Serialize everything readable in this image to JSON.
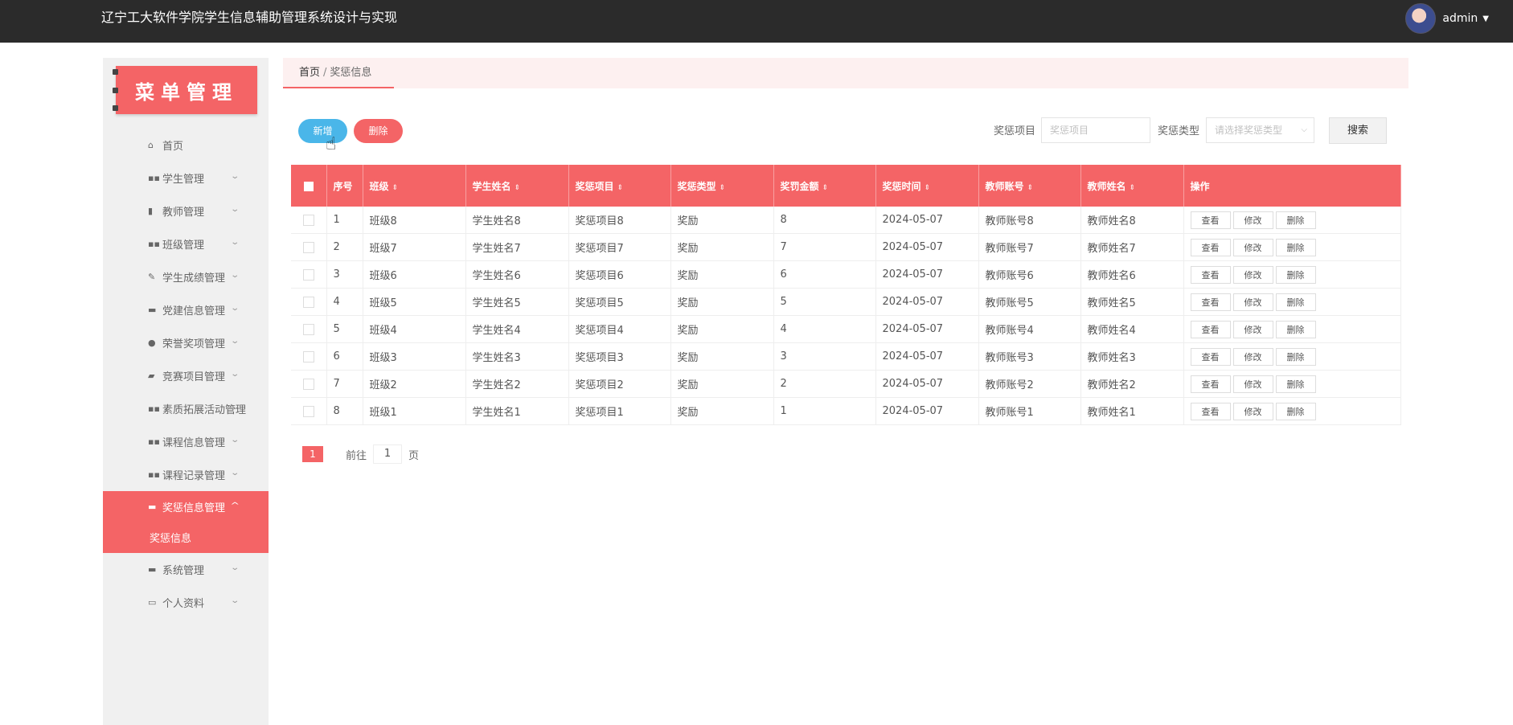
{
  "header": {
    "title": "辽宁工大软件学院学生信息辅助管理系统设计与实现",
    "username": "admin"
  },
  "sidebar": {
    "header": "菜单管理",
    "items": [
      {
        "icon": "home-icon",
        "label": "首页"
      },
      {
        "icon": "grid-icon",
        "label": "学生管理"
      },
      {
        "icon": "chart-icon",
        "label": "教师管理"
      },
      {
        "icon": "grid-icon",
        "label": "班级管理"
      },
      {
        "icon": "edit-icon",
        "label": "学生成绩管理"
      },
      {
        "icon": "comment-icon",
        "label": "党建信息管理"
      },
      {
        "icon": "user-icon",
        "label": "荣誉奖项管理"
      },
      {
        "icon": "briefcase-icon",
        "label": "竞赛项目管理"
      },
      {
        "icon": "grid-icon",
        "label": "素质拓展活动管理"
      },
      {
        "icon": "grid-icon",
        "label": "课程信息管理"
      },
      {
        "icon": "grid-icon",
        "label": "课程记录管理"
      },
      {
        "icon": "comment-icon",
        "label": "奖惩信息管理"
      },
      {
        "icon": "comment-icon",
        "label": "系统管理"
      },
      {
        "icon": "card-icon",
        "label": "个人资料"
      }
    ],
    "active_submenu": "奖惩信息"
  },
  "breadcrumb": {
    "home": "首页",
    "separator": "/",
    "current": "奖惩信息"
  },
  "toolbar": {
    "add_label": "新增",
    "delete_label": "删除",
    "filter1_label": "奖惩项目",
    "filter1_placeholder": "奖惩项目",
    "filter2_label": "奖惩类型",
    "filter2_placeholder": "请选择奖惩类型",
    "search_label": "搜索"
  },
  "table": {
    "columns": [
      "序号",
      "班级",
      "学生姓名",
      "奖惩项目",
      "奖惩类型",
      "奖罚金额",
      "奖惩时间",
      "教师账号",
      "教师姓名",
      "操作"
    ],
    "rows": [
      [
        "1",
        "班级8",
        "学生姓名8",
        "奖惩项目8",
        "奖励",
        "8",
        "2024-05-07",
        "教师账号8",
        "教师姓名8"
      ],
      [
        "2",
        "班级7",
        "学生姓名7",
        "奖惩项目7",
        "奖励",
        "7",
        "2024-05-07",
        "教师账号7",
        "教师姓名7"
      ],
      [
        "3",
        "班级6",
        "学生姓名6",
        "奖惩项目6",
        "奖励",
        "6",
        "2024-05-07",
        "教师账号6",
        "教师姓名6"
      ],
      [
        "4",
        "班级5",
        "学生姓名5",
        "奖惩项目5",
        "奖励",
        "5",
        "2024-05-07",
        "教师账号5",
        "教师姓名5"
      ],
      [
        "5",
        "班级4",
        "学生姓名4",
        "奖惩项目4",
        "奖励",
        "4",
        "2024-05-07",
        "教师账号4",
        "教师姓名4"
      ],
      [
        "6",
        "班级3",
        "学生姓名3",
        "奖惩项目3",
        "奖励",
        "3",
        "2024-05-07",
        "教师账号3",
        "教师姓名3"
      ],
      [
        "7",
        "班级2",
        "学生姓名2",
        "奖惩项目2",
        "奖励",
        "2",
        "2024-05-07",
        "教师账号2",
        "教师姓名2"
      ],
      [
        "8",
        "班级1",
        "学生姓名1",
        "奖惩项目1",
        "奖励",
        "1",
        "2024-05-07",
        "教师账号1",
        "教师姓名1"
      ]
    ],
    "row_actions": [
      "查看",
      "修改",
      "删除"
    ]
  },
  "pagination": {
    "current_page": "1",
    "goto_label": "前往",
    "goto_value": "1",
    "page_suffix": "页"
  },
  "colors": {
    "accent": "#f46466",
    "add_button": "#4ab6e9",
    "topbar": "#2b2b2b"
  }
}
